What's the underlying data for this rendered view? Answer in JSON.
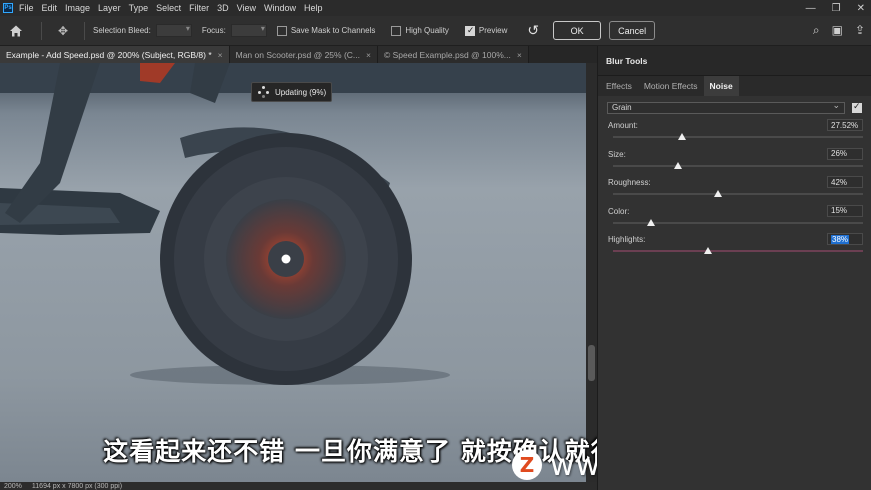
{
  "menu": [
    "File",
    "Edit",
    "Image",
    "Layer",
    "Type",
    "Select",
    "Filter",
    "3D",
    "View",
    "Window",
    "Help"
  ],
  "window_controls": {
    "minimize": "—",
    "restore": "❐",
    "close": "✕"
  },
  "options": {
    "selection_bleed_label": "Selection Bleed:",
    "focus_label": "Focus:",
    "save_mask_label": "Save Mask to Channels",
    "save_mask_checked": false,
    "high_quality_label": "High Quality",
    "high_quality_checked": false,
    "preview_label": "Preview",
    "preview_checked": true,
    "ok_label": "OK",
    "cancel_label": "Cancel"
  },
  "tabs": [
    {
      "label": "Example - Add Speed.psd @ 200% (Subject, RGB/8) *",
      "active": true
    },
    {
      "label": "Man on Scooter.psd @ 25% (C...",
      "active": false
    },
    {
      "label": "© Speed Example.psd @ 100%...",
      "active": false
    }
  ],
  "tab_close": "×",
  "updating_label": "Updating (9%)",
  "status": {
    "zoom": "200%",
    "dimensions": "11694 px x 7800 px (300 ppi)"
  },
  "subtitle": "这看起来还不错 一旦你满意了 就按确认就行",
  "watermark": {
    "logo": "Z",
    "text": "www.MacZ.com"
  },
  "panel": {
    "title": "Blur Tools",
    "tabs": [
      {
        "label": "Effects",
        "active": false
      },
      {
        "label": "Motion Effects",
        "active": false
      },
      {
        "label": "Noise",
        "active": true
      }
    ],
    "noise_type": "Grain",
    "noise_enabled": true,
    "params": [
      {
        "label": "Amount:",
        "value": "27.52%",
        "level": 0.2752,
        "selected": false
      },
      {
        "label": "Size:",
        "value": "26%",
        "level": 0.26,
        "selected": false
      },
      {
        "label": "Roughness:",
        "value": "42%",
        "level": 0.42,
        "selected": false
      },
      {
        "label": "Color:",
        "value": "15%",
        "level": 0.15,
        "selected": false
      },
      {
        "label": "Highlights:",
        "value": "38%",
        "level": 0.38,
        "selected": true
      }
    ]
  },
  "colors": {
    "accent": "#31a8ff",
    "selection": "#1f6fd0",
    "wheel_hub_red": "#b8402a"
  }
}
